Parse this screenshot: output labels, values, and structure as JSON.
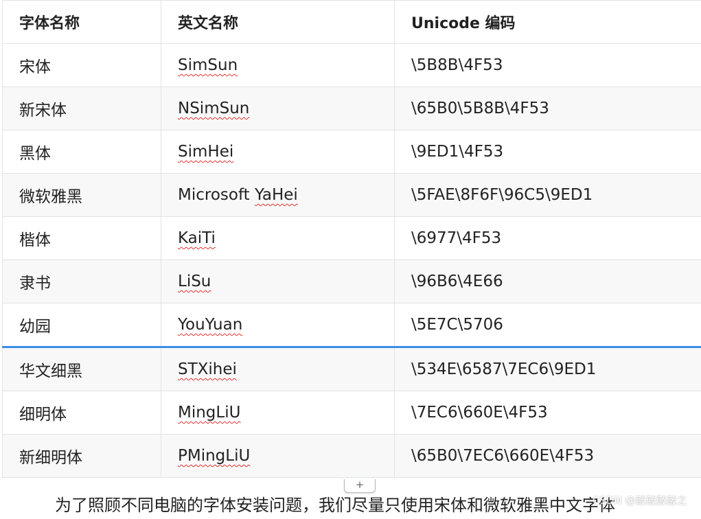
{
  "table": {
    "headers": [
      "字体名称",
      "英文名称",
      "Unicode  编码"
    ],
    "rows": [
      {
        "cn": "宋体",
        "en": "SimSun",
        "code": "\\5B8B\\4F53"
      },
      {
        "cn": "新宋体",
        "en": "NSimSun",
        "code": "\\65B0\\5B8B\\4F53"
      },
      {
        "cn": "黑体",
        "en": "SimHei",
        "code": "\\9ED1\\4F53"
      },
      {
        "cn": "微软雅黑",
        "en_prefix": "Microsoft ",
        "en": "YaHei",
        "code": "\\5FAE\\8F6F\\96C5\\9ED1"
      },
      {
        "cn": "楷体",
        "en": "KaiTi",
        "code": "\\6977\\4F53"
      },
      {
        "cn": "隶书",
        "en": "LiSu",
        "code": "\\96B6\\4E66"
      },
      {
        "cn": "幼园",
        "en": "YouYuan",
        "code": "\\5E7C\\5706"
      },
      {
        "cn": "华文细黑",
        "en": "STXihei",
        "code": "\\534E\\6587\\7EC6\\9ED1"
      },
      {
        "cn": "细明体",
        "en": "MingLiU",
        "code": "\\7EC6\\660E\\4F53"
      },
      {
        "cn": "新细明体",
        "en": "PMingLiU",
        "code": "\\65B0\\7EC6\\660E\\4F53"
      }
    ]
  },
  "add_row": {
    "label": "+"
  },
  "paragraph": {
    "text": "为了照顾不同电脑的字体安装问题，我们尽量只使用宋体和微软雅黑中文字体"
  },
  "watermark": {
    "text": "CSDN @敲敲敲敲之"
  },
  "colors": {
    "drop_indicator": "#3a8ee6",
    "spell_underline": "#e03131",
    "border": "#dfe2e5",
    "stripe": "#f8f8f8"
  }
}
